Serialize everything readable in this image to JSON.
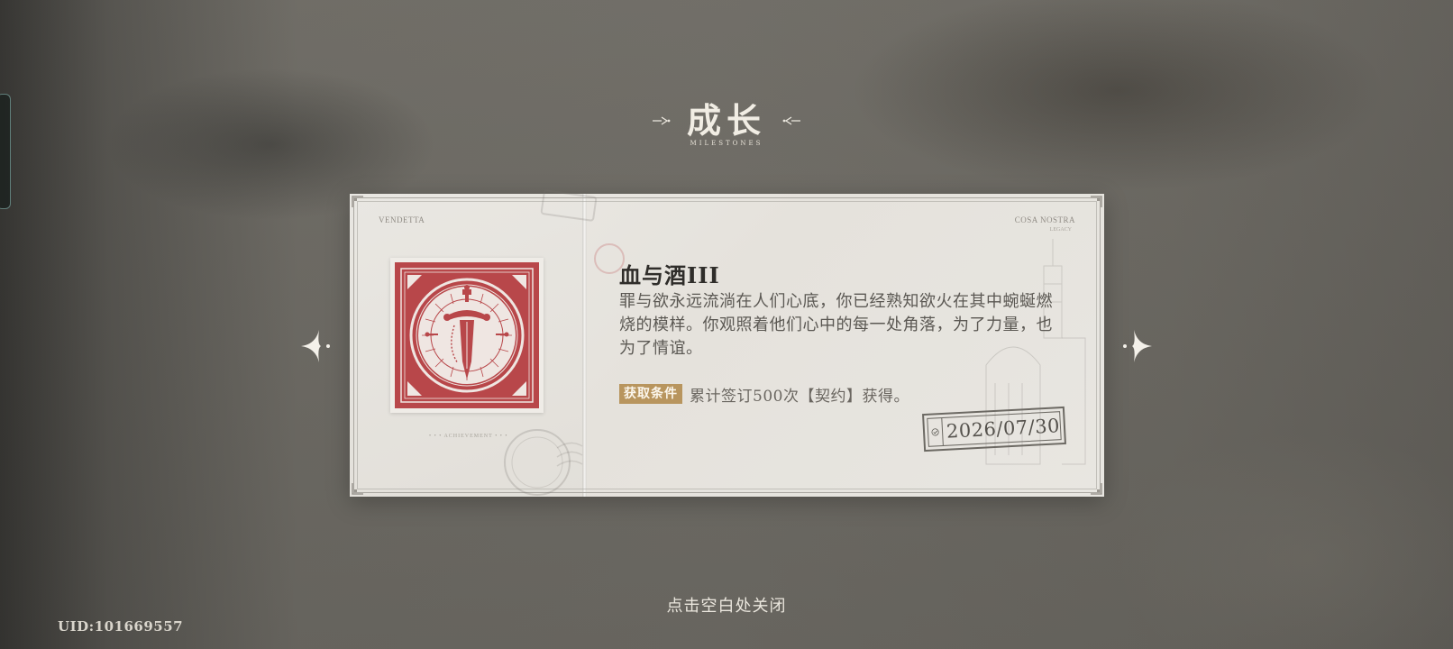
{
  "header": {
    "title": "成长",
    "subtitle": "MILESTONES"
  },
  "card": {
    "tag_left": "VENDETTA",
    "tag_right": "COSA NOSTRA",
    "tag_right_sub": "LEGACY",
    "tag_bottom": "• • • ACHIEVEMENT • • •",
    "achievement_name": "血与酒III",
    "description": "罪与欲永远流淌在人们心底，你已经熟知欲火在其中蜿蜒燃烧的模样。你观照着他们心中的每一处角落，为了力量，也为了情谊。",
    "condition_label": "获取条件",
    "condition_text": "累计签订500次【契约】获得。",
    "date": "2026/07/30",
    "emblem_icon": "dagger-emblem-icon",
    "colors": {
      "emblem_red": "#b8474a",
      "badge_gold": "#b8955e",
      "paper": "#e8e6e1"
    }
  },
  "navigation": {
    "prev_icon": "four-point-star-arrow-left-icon",
    "next_icon": "four-point-star-arrow-right-icon"
  },
  "footer": {
    "close_hint": "点击空白处关闭",
    "uid": "UID:101669557"
  }
}
